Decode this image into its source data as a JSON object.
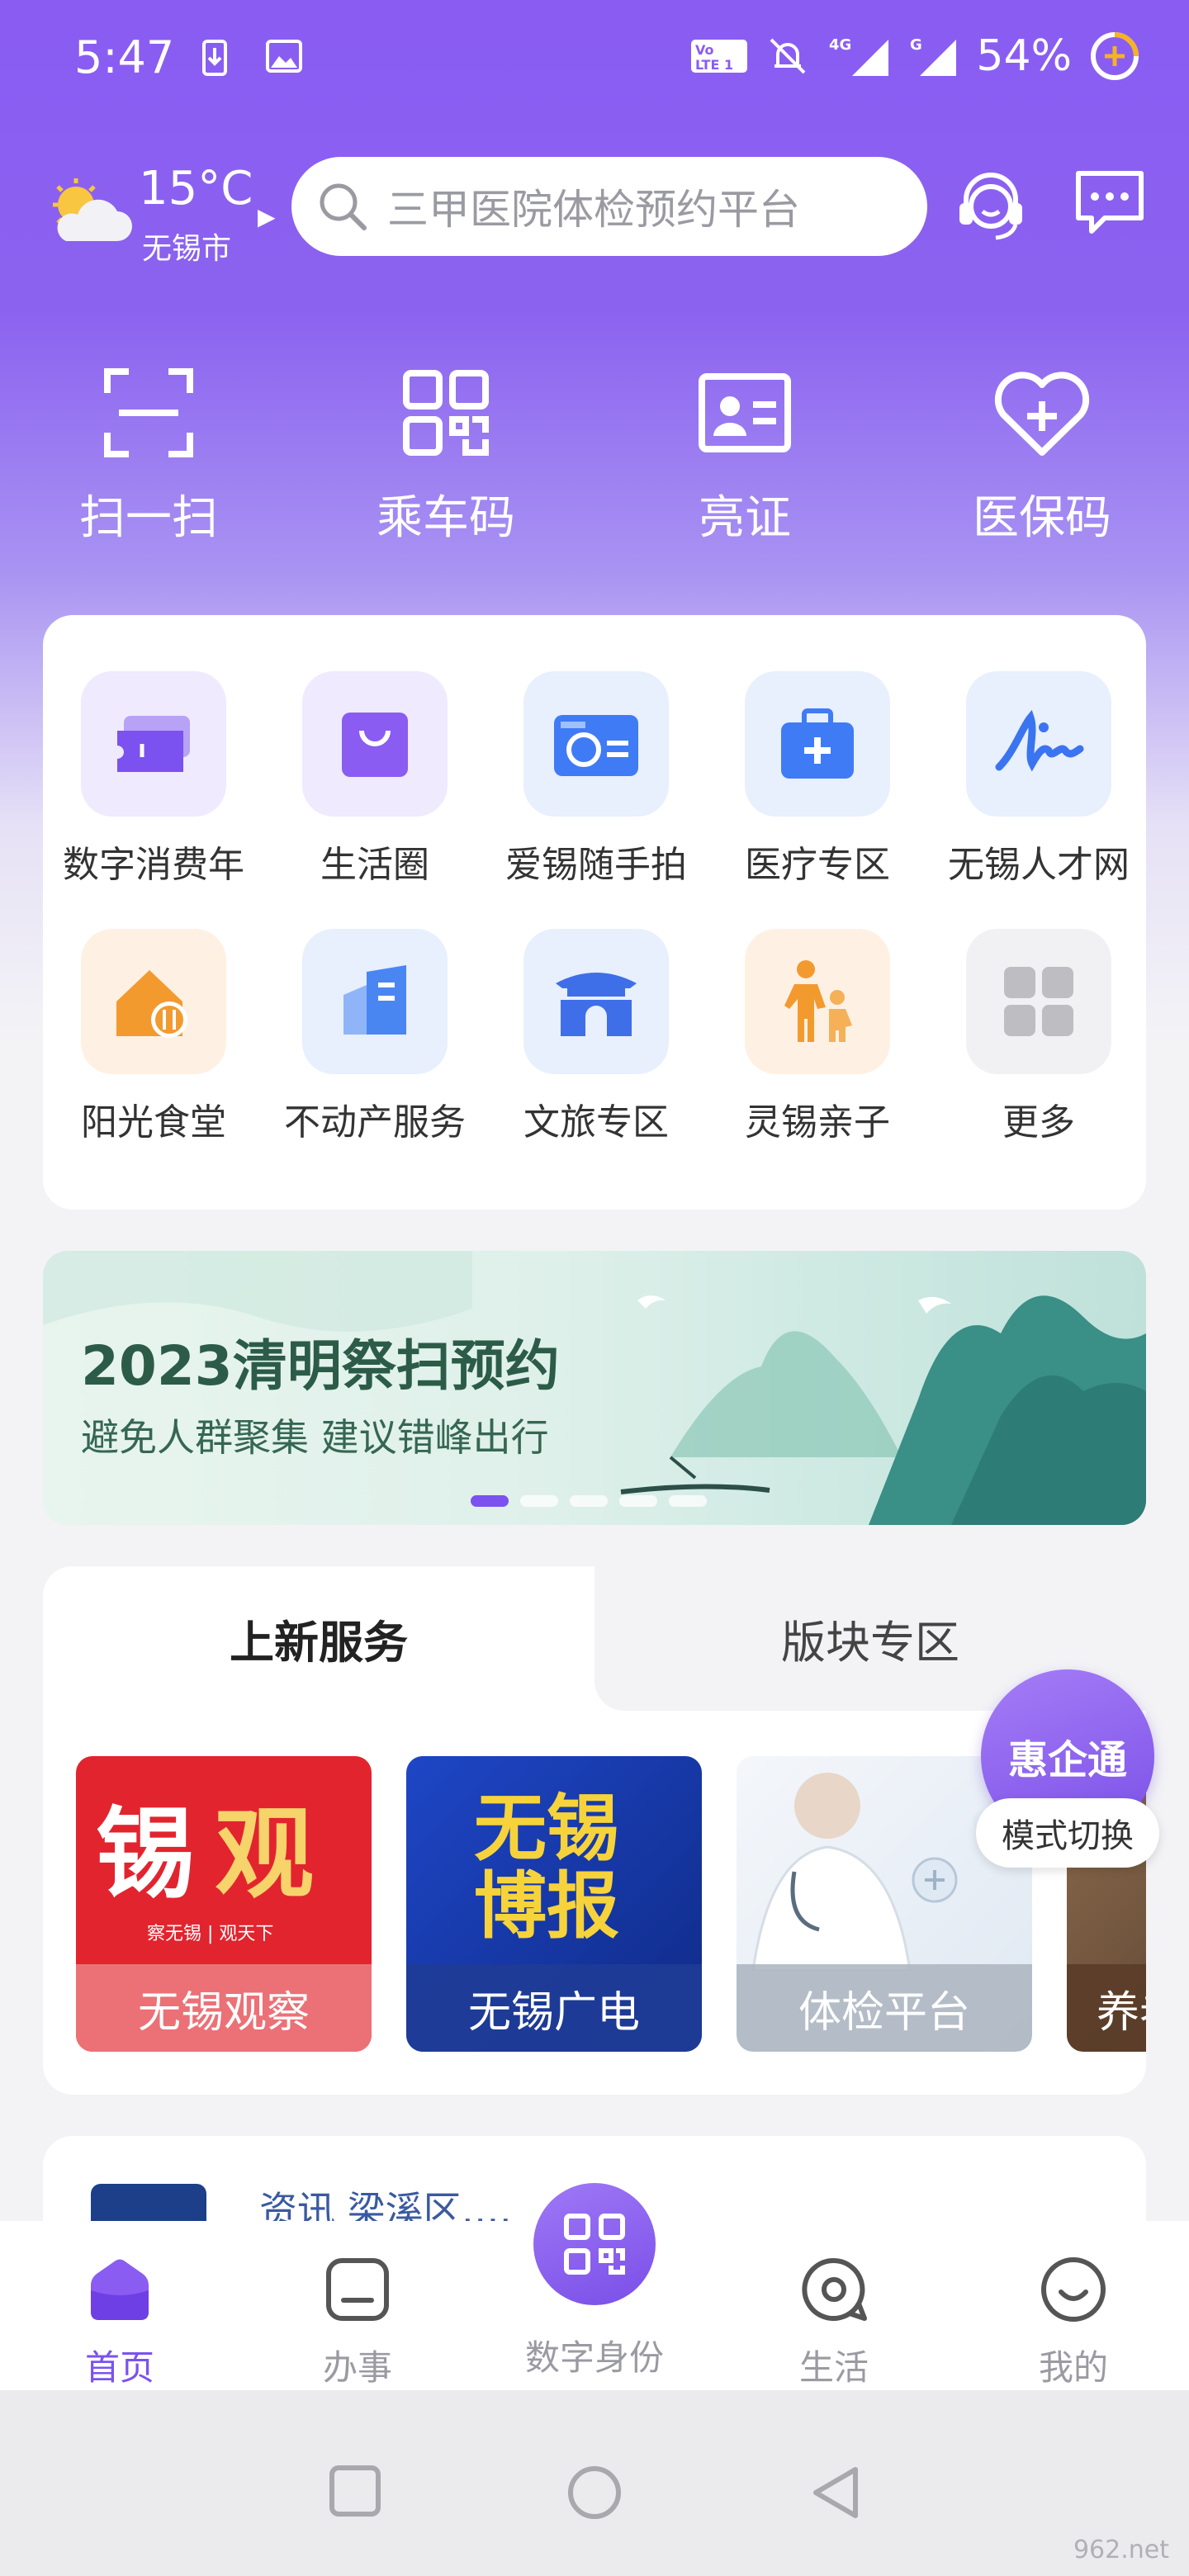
{
  "status_bar": {
    "time": "5:47",
    "network": "4G",
    "battery": "54%"
  },
  "header": {
    "weather": {
      "temp": "15°C",
      "city": "无锡市",
      "icon": "partly-cloudy-icon"
    },
    "search": {
      "placeholder": "三甲医院体检预约平台"
    },
    "icons": [
      "customer-service-icon",
      "message-icon"
    ]
  },
  "quick_actions": [
    {
      "label": "扫一扫",
      "icon": "scan-icon"
    },
    {
      "label": "乘车码",
      "icon": "qr-code-icon"
    },
    {
      "label": "亮证",
      "icon": "id-card-icon"
    },
    {
      "label": "医保码",
      "icon": "heart-plus-icon"
    }
  ],
  "services": [
    {
      "label": "数字消费年",
      "icon": "ticket-icon",
      "color": "#7b52f0"
    },
    {
      "label": "生活圈",
      "icon": "shopping-bag-icon",
      "color": "#8a5cf2"
    },
    {
      "label": "爱锡随手拍",
      "icon": "camera-icon",
      "color": "#3f7bf5"
    },
    {
      "label": "医疗专区",
      "icon": "medical-kit-icon",
      "color": "#3f7bf5"
    },
    {
      "label": "无锡人才网",
      "icon": "signature-icon",
      "color": "#3a74f0"
    },
    {
      "label": "阳光食堂",
      "icon": "house-dining-icon",
      "color": "#f39a2e"
    },
    {
      "label": "不动产服务",
      "icon": "building-icon",
      "color": "#4a86f2"
    },
    {
      "label": "文旅专区",
      "icon": "gate-icon",
      "color": "#3f6fe8"
    },
    {
      "label": "灵锡亲子",
      "icon": "parent-child-icon",
      "color": "#f39a2e"
    },
    {
      "label": "更多",
      "icon": "grid-more-icon",
      "color": "#bdbdc2"
    }
  ],
  "banner": {
    "title": "2023清明祭扫预约",
    "subtitle": "避免人群聚集 建议错峰出行"
  },
  "new_services": {
    "tabs": [
      {
        "label": "上新服务",
        "active": true
      },
      {
        "label": "版块专区",
        "active": false
      }
    ],
    "items": [
      {
        "caption": "无锡观察",
        "art_text": "锡观",
        "art_sub": "察无锡 | 观天下"
      },
      {
        "caption": "无锡广电",
        "art_text": "无锡博报"
      },
      {
        "caption": "体检平台"
      },
      {
        "caption": "养老"
      }
    ]
  },
  "floating_badge": {
    "title": "惠企通",
    "action": "模式切换"
  },
  "info_card": {
    "text": "资讯    梁溪区……乡记”"
  },
  "bottom_nav": [
    {
      "label": "首页",
      "icon": "home-icon",
      "active": true
    },
    {
      "label": "办事",
      "icon": "task-icon",
      "active": false
    },
    {
      "label": "数字身份",
      "icon": "qr-code-icon",
      "active": false
    },
    {
      "label": "生活",
      "icon": "life-icon",
      "active": false
    },
    {
      "label": "我的",
      "icon": "profile-icon",
      "active": false
    }
  ],
  "watermark": "962.net"
}
